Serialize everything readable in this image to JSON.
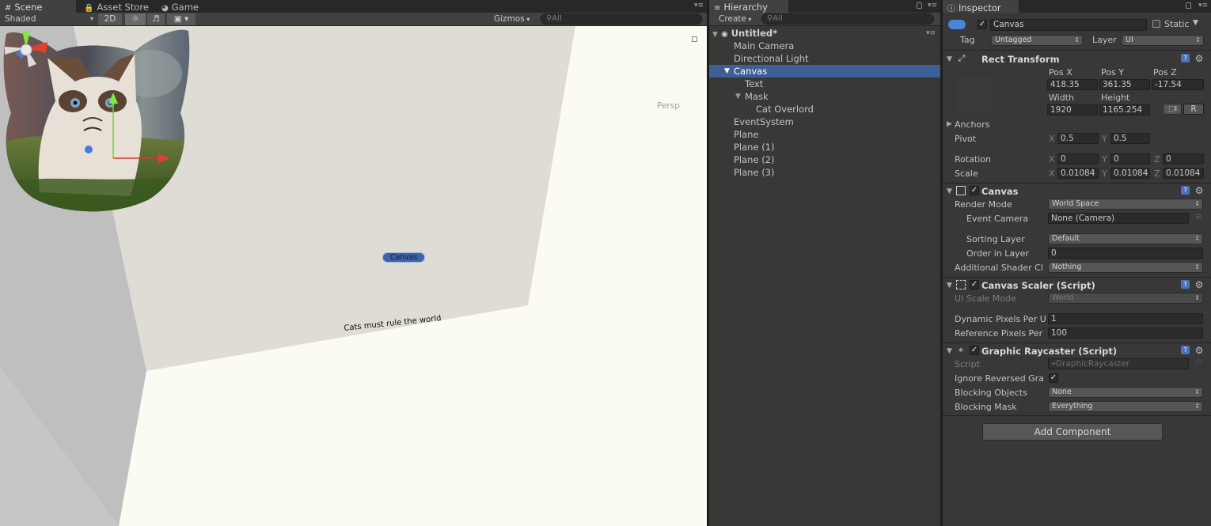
{
  "scene": {
    "tabs": [
      {
        "label": "Scene",
        "icon": "grid-icon"
      },
      {
        "label": "Asset Store",
        "icon": "lock-bag-icon"
      },
      {
        "label": "Game",
        "icon": "pacman-icon"
      }
    ],
    "toolbar": {
      "shading_mode": "Shaded",
      "mode_2d": "2D",
      "gizmos_label": "Gizmos",
      "search_placeholder": "All"
    },
    "viewport": {
      "canvas_label": "Canvas",
      "caption": "Cats must rule the world",
      "projection_label": "Persp"
    }
  },
  "hierarchy": {
    "tab_label": "Hierarchy",
    "create_label": "Create",
    "search_placeholder": "All",
    "root": "Untitled*",
    "items": [
      {
        "label": "Main Camera",
        "depth": 0,
        "selected": false
      },
      {
        "label": "Directional Light",
        "depth": 0,
        "selected": false
      },
      {
        "label": "Canvas",
        "depth": 0,
        "selected": true,
        "expanded": true
      },
      {
        "label": "Text",
        "depth": 1,
        "selected": false
      },
      {
        "label": "Mask",
        "depth": 1,
        "selected": false,
        "expanded": true
      },
      {
        "label": "Cat Overlord",
        "depth": 2,
        "selected": false
      },
      {
        "label": "EventSystem",
        "depth": 0,
        "selected": false
      },
      {
        "label": "Plane",
        "depth": 0,
        "selected": false
      },
      {
        "label": "Plane (1)",
        "depth": 0,
        "selected": false
      },
      {
        "label": "Plane (2)",
        "depth": 0,
        "selected": false
      },
      {
        "label": "Plane (3)",
        "depth": 0,
        "selected": false
      }
    ]
  },
  "inspector": {
    "tab_label": "Inspector",
    "object": {
      "active": true,
      "name": "Canvas",
      "static_label": "Static",
      "static": false,
      "tag_label": "Tag",
      "tag": "Untagged",
      "layer_label": "Layer",
      "layer": "UI"
    },
    "rect_transform": {
      "title": "Rect Transform",
      "pos_x_label": "Pos X",
      "pos_x": "418.35",
      "pos_y_label": "Pos Y",
      "pos_y": "361.35",
      "pos_z_label": "Pos Z",
      "pos_z": "-17.54",
      "width_label": "Width",
      "width": "1920",
      "height_label": "Height",
      "height": "1165.254",
      "r_label": "R",
      "anchors_label": "Anchors",
      "pivot_label": "Pivot",
      "pivot_x": "0.5",
      "pivot_y": "0.5",
      "rotation_label": "Rotation",
      "rot_x": "0",
      "rot_y": "0",
      "rot_z": "0",
      "scale_label": "Scale",
      "scale_x": "0.01084",
      "scale_y": "0.01084",
      "scale_z": "0.01084",
      "x": "X",
      "y": "Y",
      "z": "Z"
    },
    "canvas": {
      "title": "Canvas",
      "enabled": true,
      "render_mode_label": "Render Mode",
      "render_mode": "World Space",
      "event_camera_label": "Event Camera",
      "event_camera": "None (Camera)",
      "sorting_layer_label": "Sorting Layer",
      "sorting_layer": "Default",
      "order_label": "Order in Layer",
      "order": "0",
      "shader_label": "Additional Shader Cl",
      "shader": "Nothing"
    },
    "canvas_scaler": {
      "title": "Canvas Scaler (Script)",
      "enabled": true,
      "ui_scale_label": "UI Scale Mode",
      "ui_scale": "World",
      "dynamic_label": "Dynamic Pixels Per U",
      "dynamic": "1",
      "reference_label": "Reference Pixels Per",
      "reference": "100"
    },
    "raycaster": {
      "title": "Graphic Raycaster (Script)",
      "enabled": true,
      "script_label": "Script",
      "script": "GraphicRaycaster",
      "ignore_label": "Ignore Reversed Gra",
      "ignore": true,
      "blocking_objects_label": "Blocking Objects",
      "blocking_objects": "None",
      "blocking_mask_label": "Blocking Mask",
      "blocking_mask": "Everything"
    },
    "add_component": "Add Component"
  }
}
